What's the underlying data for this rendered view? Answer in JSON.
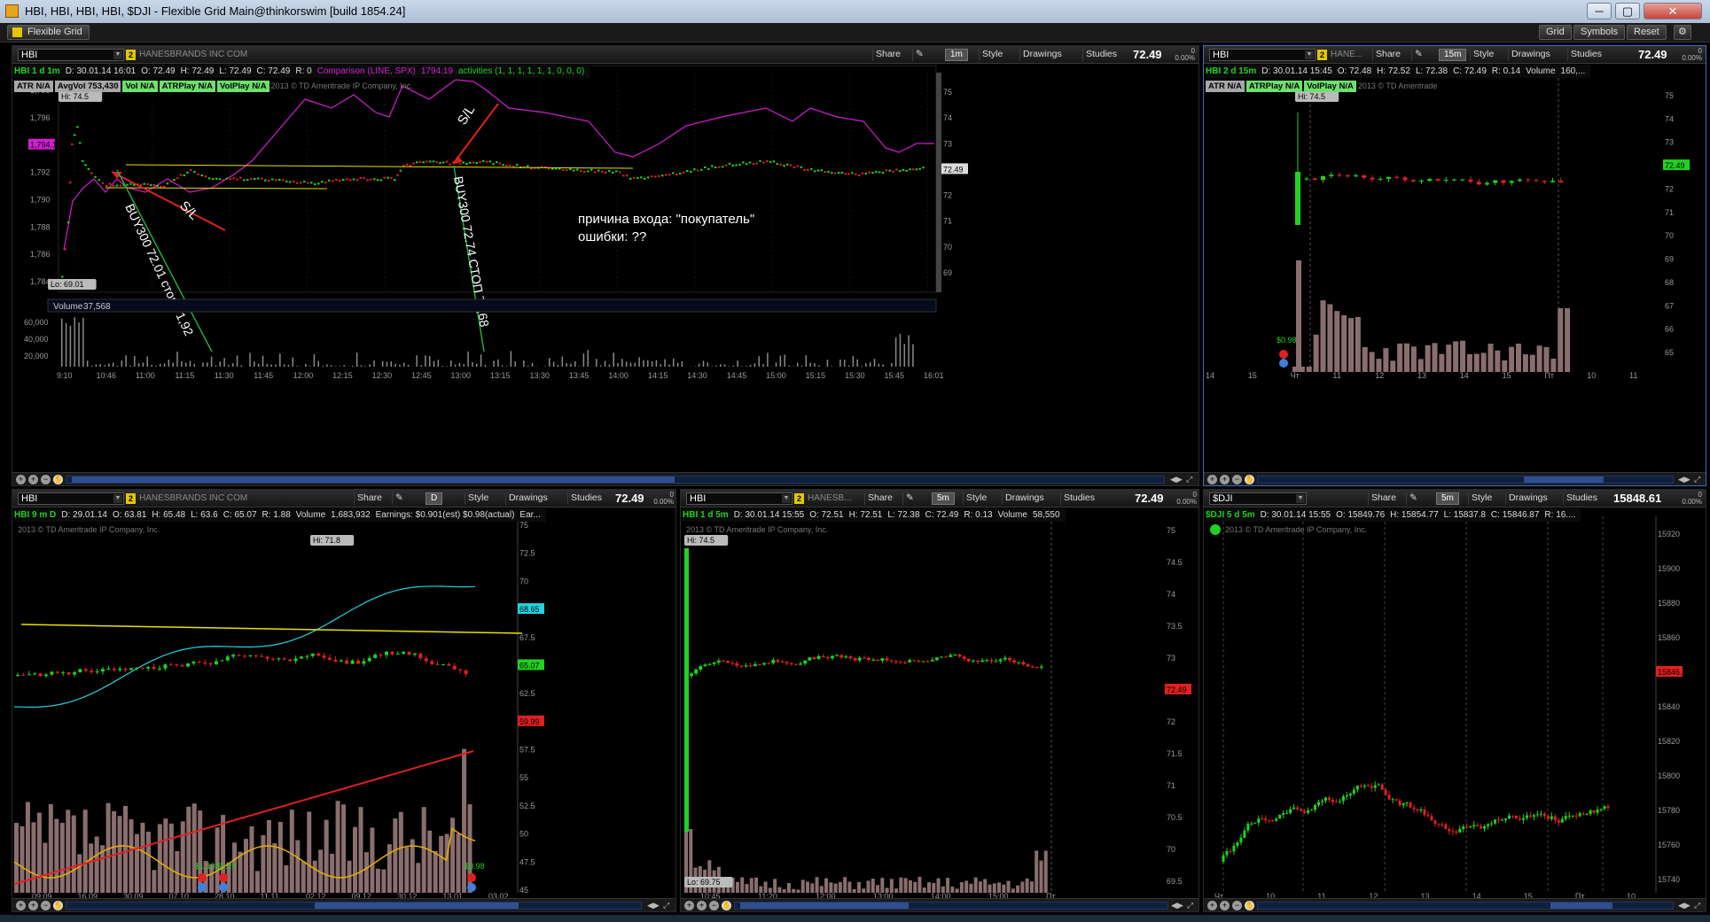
{
  "window": {
    "title": "HBI, HBI, HBI, HBI, $DJI - Flexible Grid Main@thinkorswim [build 1854.24]"
  },
  "toolbar": {
    "layout": "Flexible Grid",
    "grid": "Grid",
    "symbols": "Symbols",
    "reset": "Reset"
  },
  "common": {
    "share": "Share",
    "style": "Style",
    "drawings": "Drawings",
    "studies": "Studies",
    "copyright": "2013 © TD Ameritrade IP Company, Inc.",
    "copyright_short": "2013 © TD Ameritrade"
  },
  "p1": {
    "symbol": "HBI",
    "link": "2",
    "company": "HANESBRANDS INC COM",
    "timeframe": "1m",
    "last": "72.49",
    "change": "0\n0.00%",
    "info": [
      "HBI 1 d 1m",
      "D: 30.01.14 16:01",
      "O: 72.49",
      "H: 72.49",
      "L: 72.49",
      "C: 72.49",
      "R: 0",
      "Comparison (LINE, SPX)",
      "1794.19",
      "activities (1, 1, 1, 1, 1, 1, 0, 0, 0)"
    ],
    "badges": [
      "ATR N/A",
      "AvgVol 753,430",
      "Vol N/A",
      "ATRPlay N/A",
      "VolPlay N/A"
    ],
    "hi_label": "Hi: 74.5",
    "lo_label": "Lo: 69.01",
    "left_scale": [
      "1,798",
      "1,796",
      "1,794.19",
      "1,792",
      "1,790",
      "1,788",
      "1,786",
      "1,784"
    ],
    "right_scale": [
      "75",
      "74",
      "73",
      "72.49",
      "72",
      "71",
      "70",
      "69"
    ],
    "volume_label": "Volume",
    "volume_value": "37,568",
    "vol_scale": [
      "60,000",
      "40,000",
      "20,000"
    ],
    "times": [
      "9:10",
      "10:46",
      "11:00",
      "11:15",
      "11:30",
      "11:45",
      "12:00",
      "12:15",
      "12:30",
      "12:45",
      "13:00",
      "13:15",
      "13:30",
      "13:45",
      "14:00",
      "14:15",
      "14:30",
      "14:45",
      "15:00",
      "15:15",
      "15:30",
      "15:45",
      "16:01"
    ],
    "annotations": {
      "sl": "S/L",
      "buy1": "BUY300 72.01 стоп 71,92",
      "buy2": "BUY300 72.74 СТОП 72,68",
      "note1": "причина входа: \"покупатель\"",
      "note2": "ошибки: ??"
    }
  },
  "p2": {
    "symbol": "HBI",
    "link": "2",
    "company": "HANE...",
    "timeframe": "15m",
    "last": "72.49",
    "change": "0\n0.00%",
    "info": [
      "HBI 2 d 15m",
      "D: 30.01.14 15:45",
      "O: 72.48",
      "H: 72.52",
      "L: 72.38",
      "C: 72.49",
      "R: 0.14",
      "Volume",
      "160,..."
    ],
    "badges": [
      "ATR N/A",
      "ATRPlay N/A",
      "VolPlay N/A"
    ],
    "hi_label": "Hi: 74.5",
    "earn": "$0.98",
    "right_scale": [
      "75",
      "74",
      "73",
      "72.49",
      "72",
      "71",
      "70",
      "69",
      "68",
      "67",
      "66",
      "65"
    ],
    "xlabels": [
      "14",
      "15",
      "Чт",
      "11",
      "12",
      "13",
      "14",
      "15",
      "Пт",
      "10",
      "11"
    ]
  },
  "p3": {
    "symbol": "HBI",
    "link": "2",
    "company": "HANESBRANDS INC COM",
    "timeframe": "D",
    "last": "72.49",
    "change": "0\n0.00%",
    "info": [
      "HBI 9 m D",
      "D: 29.01.14",
      "O: 63.81",
      "H: 65.48",
      "L: 63.6",
      "C: 65.07",
      "R: 1.88",
      "Volume",
      "1,683,932",
      "Earnings: $0.901(est) $0.98(actual)",
      "Ear..."
    ],
    "hi_label": "Hi: 71.8",
    "right_scale": [
      "75",
      "72.5",
      "70",
      "68.65",
      "67.5",
      "65.07",
      "62.5",
      "59.99",
      "57.5",
      "55",
      "52.5",
      "50",
      "47.5",
      "45"
    ],
    "earn": [
      "$1.13",
      "$0.20",
      "$0.98"
    ],
    "xlabels": [
      "09.09",
      "16.09",
      "30.09",
      "07.10",
      "28.10",
      "11.11",
      "02.12",
      "09.12",
      "30.12",
      "13.01",
      "03.02"
    ]
  },
  "p4": {
    "symbol": "HBI",
    "link": "2",
    "company": "HANESB...",
    "timeframe": "5m",
    "last": "72.49",
    "change": "0\n0.00%",
    "info": [
      "HBI 1 d 5m",
      "D: 30.01.14 15:55",
      "O: 72.51",
      "H: 72.51",
      "L: 72.38",
      "C: 72.49",
      "R: 0.13",
      "Volume",
      "58,550"
    ],
    "hi_label": "Hi: 74.5",
    "lo_label": "Lo: 69.75",
    "right_scale": [
      "75",
      "74.5",
      "74",
      "73.5",
      "73",
      "72.49",
      "72",
      "71.5",
      "71",
      "70.5",
      "70",
      "69.5"
    ],
    "xlabels": [
      "10:45",
      "11:20",
      "12:00",
      "13:00",
      "14:00",
      "15:00",
      "Пт"
    ]
  },
  "p5": {
    "symbol": "$DJI",
    "timeframe": "5m",
    "last": "15848.61",
    "change": "0\n0.00%",
    "info": [
      "$DJI 5 d 5m",
      "D: 30.01.14 15:55",
      "O: 15849.76",
      "H: 15854.77",
      "L: 15837.8",
      "C: 15846.87",
      "R: 16...."
    ],
    "right_scale": [
      "15920",
      "15900",
      "15880",
      "15860",
      "15846.87",
      "15840",
      "15820",
      "15800",
      "15780",
      "15760",
      "15740"
    ],
    "xlabels": [
      "Чт",
      "10",
      "11",
      "12",
      "13",
      "14",
      "15",
      "Пт",
      "10"
    ]
  },
  "colors": {
    "up": "#1fd21f",
    "down": "#e02020",
    "compare": "#d21ed2",
    "trend": "#e8e000",
    "accent": "#3f6fbf"
  }
}
